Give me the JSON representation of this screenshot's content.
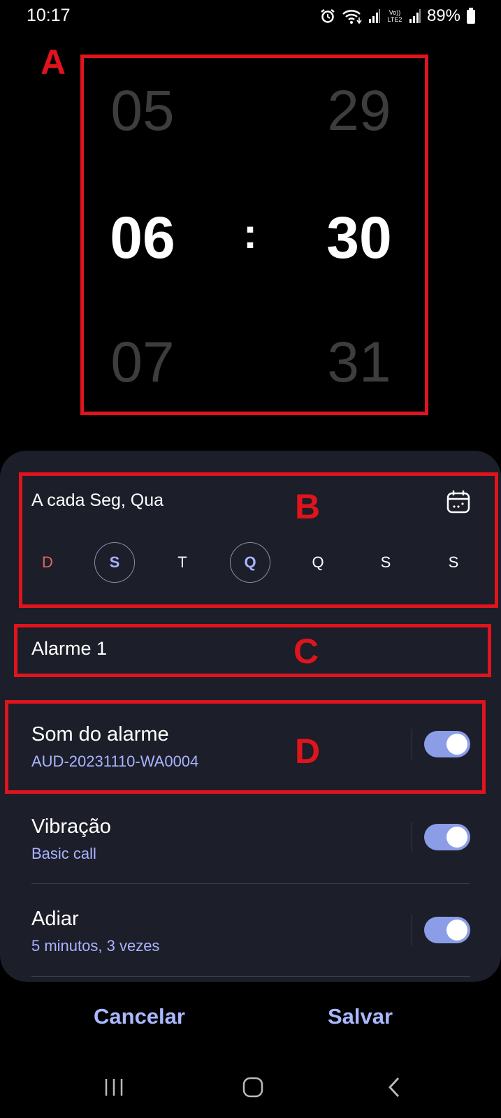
{
  "status_bar": {
    "time": "10:17",
    "battery": "89%",
    "icons": [
      "alarm-icon",
      "wifi-icon",
      "signal-icon",
      "volte-icon",
      "signal-icon",
      "battery-icon"
    ],
    "volte_text": "Vo)) LTE2"
  },
  "annotations": {
    "a": "A",
    "b": "B",
    "c": "C",
    "d": "D"
  },
  "time_picker": {
    "hour_prev": "05",
    "hour": "06",
    "hour_next": "07",
    "separator": ":",
    "minute_prev": "29",
    "minute": "30",
    "minute_next": "31"
  },
  "repeat": {
    "label": "A cada Seg, Qua",
    "calendar_icon": "calendar-icon",
    "days": [
      {
        "label": "D",
        "selected": false
      },
      {
        "label": "S",
        "selected": true
      },
      {
        "label": "T",
        "selected": false
      },
      {
        "label": "Q",
        "selected": true
      },
      {
        "label": "Q",
        "selected": false
      },
      {
        "label": "S",
        "selected": false
      },
      {
        "label": "S",
        "selected": false
      }
    ]
  },
  "alarm_name": "Alarme 1",
  "settings": [
    {
      "title": "Som do alarme",
      "subtitle": "AUD-20231110-WA0004",
      "enabled": true
    },
    {
      "title": "Vibração",
      "subtitle": "Basic call",
      "enabled": true
    },
    {
      "title": "Adiar",
      "subtitle": "5 minutos, 3 vezes",
      "enabled": true
    }
  ],
  "buttons": {
    "cancel": "Cancelar",
    "save": "Salvar"
  },
  "nav": [
    "recents-icon",
    "home-icon",
    "back-icon"
  ],
  "colors": {
    "accent": "#aab8ff",
    "toggle_on": "#8b9de6",
    "sheet_bg": "#1c1e29",
    "marker": "#e0141c",
    "sunday": "#e0665f"
  }
}
